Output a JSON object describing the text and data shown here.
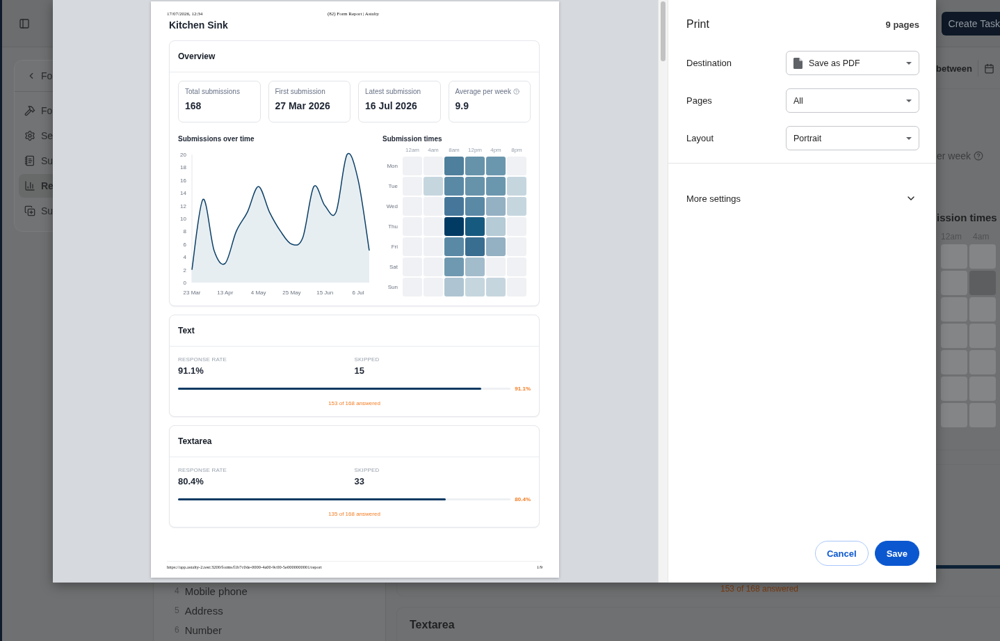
{
  "app": {
    "nav_back": "Fo",
    "nav_items": [
      {
        "label": "Fo",
        "selected": false
      },
      {
        "label": "Se",
        "selected": false
      },
      {
        "label": "Su",
        "selected": false
      },
      {
        "label": "Re",
        "selected": true
      },
      {
        "label": "Su",
        "selected": false
      }
    ],
    "header_button": "Create Task",
    "filter_text": "between",
    "stat_fragment": "er week",
    "heatmap_title_fragment": "ission times",
    "heatmap_hours": [
      "12am",
      "4am"
    ],
    "heatmap_rows": [
      {
        "cells": [
          {
            "color": "#848586"
          },
          {
            "color": "#848586"
          }
        ]
      },
      {
        "cells": [
          {
            "color": "#848586"
          },
          {
            "color": "#5c5e60"
          }
        ]
      },
      {
        "cells": [
          {
            "color": "#848586"
          },
          {
            "color": "#848586"
          }
        ]
      },
      {
        "cells": [
          {
            "color": "#848586"
          },
          {
            "color": "#848586"
          }
        ]
      },
      {
        "cells": [
          {
            "color": "#848586"
          },
          {
            "color": "#848586"
          }
        ]
      },
      {
        "cells": [
          {
            "color": "#848586"
          },
          {
            "color": "#848586"
          }
        ]
      },
      {
        "cells": [
          {
            "color": "#848586"
          },
          {
            "color": "#848586"
          }
        ]
      }
    ],
    "progress": {
      "level": 0.911
    },
    "answered_note": "153 of 168 answered",
    "fields": [
      {
        "number": "4",
        "label": "Mobile phone"
      },
      {
        "number": "5",
        "label": "Address"
      },
      {
        "number": "6",
        "label": "Number"
      }
    ],
    "next_card_title": "Textarea"
  },
  "print_dialog": {
    "preview": {
      "print_header": {
        "date": "17/07/2026, 12:34",
        "title": "(82) Form Report | Astalty"
      },
      "title": "Kitchen Sink",
      "overview": {
        "title": "Overview",
        "stats": [
          {
            "label": "Total submissions",
            "value": "168",
            "help": false
          },
          {
            "label": "First submission",
            "value": "27 Mar 2026",
            "help": false
          },
          {
            "label": "Latest submission",
            "value": "16 Jul 2026",
            "help": false
          },
          {
            "label": "Average per week",
            "value": "9.9",
            "help": true
          }
        ],
        "line_chart": {
          "title": "Submissions over time",
          "chart_data": {
            "type": "area",
            "categories": [
              "23 Mar",
              null,
              null,
              "13 Apr",
              null,
              null,
              "4 May",
              null,
              null,
              "25 May",
              null,
              null,
              "15 Jun",
              null,
              null,
              "6 Jul",
              null
            ],
            "series": [
              {
                "color": "#0b3f66",
                "values": [
                  2,
                  13,
                  5,
                  3,
                  8,
                  11,
                  15,
                  11,
                  8,
                  6,
                  7,
                  15,
                  12,
                  11,
                  20,
                  16,
                  5
                ]
              }
            ],
            "ylim": [
              0,
              20
            ],
            "yticks": [
              0,
              2,
              4,
              6,
              8,
              10,
              12,
              14,
              16,
              18,
              20
            ]
          }
        },
        "heatmap": {
          "title": "Submission times",
          "hours": [
            "12am",
            "4am",
            "8am",
            "12pm",
            "4pm",
            "8pm"
          ],
          "rows": [
            {
              "day": "Mon",
              "cells": [
                {
                  "color": "#f0f1f4"
                },
                {
                  "color": "#f0f1f4"
                },
                {
                  "color": "#4e7f9c"
                },
                {
                  "color": "#6693aa"
                },
                {
                  "color": "#6b97ae"
                },
                {
                  "color": "#f0f1f4"
                }
              ]
            },
            {
              "day": "Tue",
              "cells": [
                {
                  "color": "#f0f1f4"
                },
                {
                  "color": "#c6d6df"
                },
                {
                  "color": "#5a89a5"
                },
                {
                  "color": "#6693aa"
                },
                {
                  "color": "#6b97ae"
                },
                {
                  "color": "#c6d6df"
                }
              ]
            },
            {
              "day": "Wed",
              "cells": [
                {
                  "color": "#f0f1f4"
                },
                {
                  "color": "#f0f1f4"
                },
                {
                  "color": "#46779a"
                },
                {
                  "color": "#5a89a5"
                },
                {
                  "color": "#94b0c3"
                },
                {
                  "color": "#c6d6df"
                }
              ]
            },
            {
              "day": "Thu",
              "cells": [
                {
                  "color": "#f0f1f4"
                },
                {
                  "color": "#f0f1f4"
                },
                {
                  "color": "#013a63"
                },
                {
                  "color": "#175a80"
                },
                {
                  "color": "#b5cbd6"
                },
                {
                  "color": "#f0f1f4"
                }
              ]
            },
            {
              "day": "Fri",
              "cells": [
                {
                  "color": "#f0f1f4"
                },
                {
                  "color": "#f0f1f4"
                },
                {
                  "color": "#5a89a5"
                },
                {
                  "color": "#3a6e91"
                },
                {
                  "color": "#94b0c3"
                },
                {
                  "color": "#f0f1f4"
                }
              ]
            },
            {
              "day": "Sat",
              "cells": [
                {
                  "color": "#f0f1f4"
                },
                {
                  "color": "#f0f1f4"
                },
                {
                  "color": "#6f99b0"
                },
                {
                  "color": "#a3bccc"
                },
                {
                  "color": "#f0f1f4"
                },
                {
                  "color": "#f0f1f4"
                }
              ]
            },
            {
              "day": "Sun",
              "cells": [
                {
                  "color": "#f0f1f4"
                },
                {
                  "color": "#f0f1f4"
                },
                {
                  "color": "#aec4d2"
                },
                {
                  "color": "#c6d6df"
                },
                {
                  "color": "#c6d6df"
                },
                {
                  "color": "#f0f1f4"
                }
              ]
            }
          ]
        }
      },
      "questions": [
        {
          "title": "Text",
          "rate_label": "RESPONSE RATE",
          "rate": "91.1%",
          "skipped_label": "SKIPPED",
          "skipped": "15",
          "level": 0.911,
          "bar_label": "91.1%",
          "answered": "153 of 168 answered"
        },
        {
          "title": "Textarea",
          "rate_label": "RESPONSE RATE",
          "rate": "80.4%",
          "skipped_label": "SKIPPED",
          "skipped": "33",
          "level": 0.804,
          "bar_label": "80.4%",
          "answered": "135 of 168 answered"
        }
      ],
      "print_footer": {
        "url": "https://app.astalty-2.test:3200/forms/f1b7c0de-0000-4a00-9c00-5e0000000001/report",
        "page": "1/9"
      }
    },
    "settings": {
      "title": "Print",
      "page_count": "9 pages",
      "fields": [
        {
          "label": "Destination",
          "value": "Save as PDF",
          "kind": "destination"
        },
        {
          "label": "Pages",
          "value": "All",
          "kind": "select"
        },
        {
          "label": "Layout",
          "value": "Portrait",
          "kind": "select"
        }
      ],
      "more": {
        "label": "More settings",
        "expanded": false
      },
      "buttons": [
        {
          "label": "Cancel",
          "kind": "secondary"
        },
        {
          "label": "Save",
          "kind": "primary"
        }
      ]
    }
  }
}
